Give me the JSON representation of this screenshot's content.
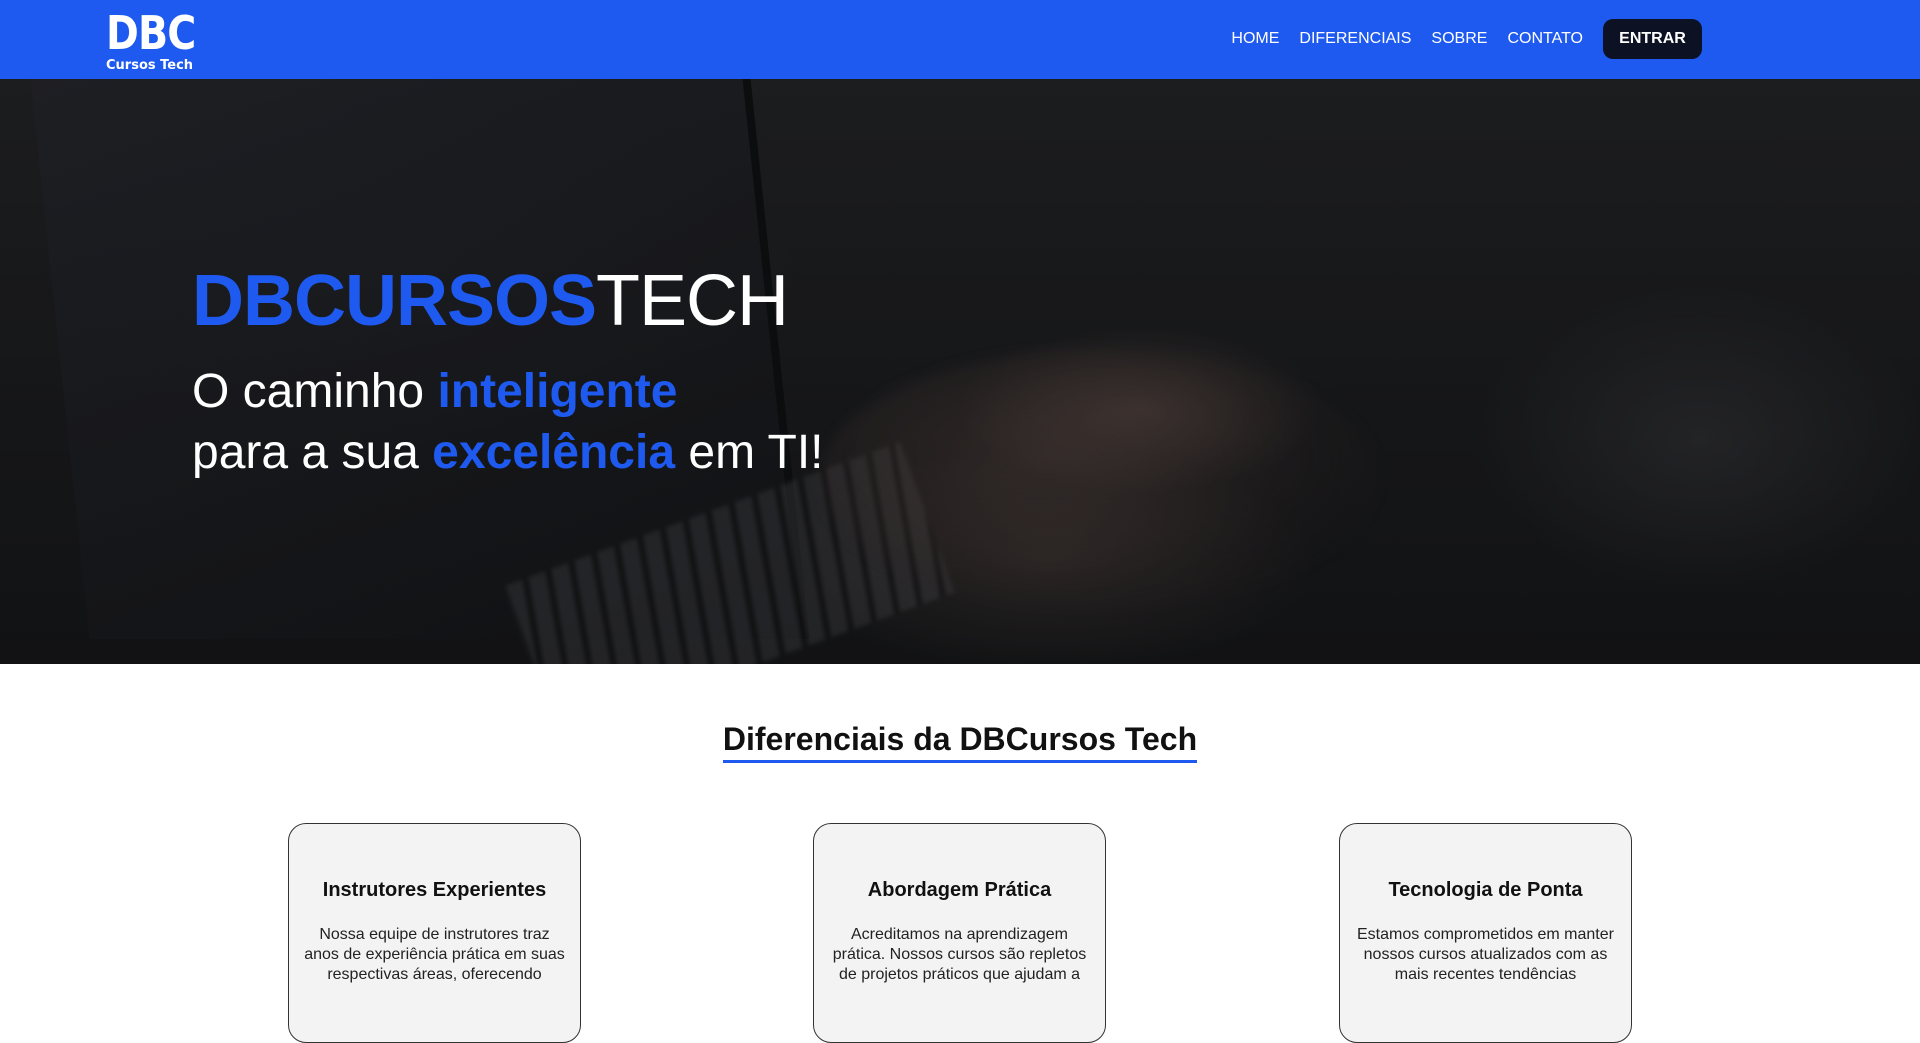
{
  "colors": {
    "primary": "#1f5af0",
    "dark_button": "#0c1224"
  },
  "navbar": {
    "logo_main": "DBC",
    "logo_sub": "Cursos Tech",
    "links": [
      "HOME",
      "DIFERENCIAIS",
      "SOBRE",
      "CONTATO"
    ],
    "cta_label": "ENTRAR"
  },
  "hero": {
    "title_accent": "DBCURSOS",
    "title_rest": "TECH",
    "line1_prefix": "O caminho ",
    "line1_accent": "inteligente",
    "line2_prefix": "para a sua ",
    "line2_accent": "excelência",
    "line2_suffix": " em TI!"
  },
  "features": {
    "title": "Diferenciais da DBCursos Tech",
    "cards": [
      {
        "title": "Instrutores Experientes",
        "text": "Nossa equipe de instrutores traz anos de experiência prática em suas respectivas áreas, oferecendo"
      },
      {
        "title": "Abordagem Prática",
        "text": "Acreditamos na aprendizagem prática. Nossos cursos são repletos de projetos práticos que ajudam a"
      },
      {
        "title": "Tecnologia de Ponta",
        "text": "Estamos comprometidos em manter nossos cursos atualizados com as mais recentes tendências"
      }
    ]
  }
}
